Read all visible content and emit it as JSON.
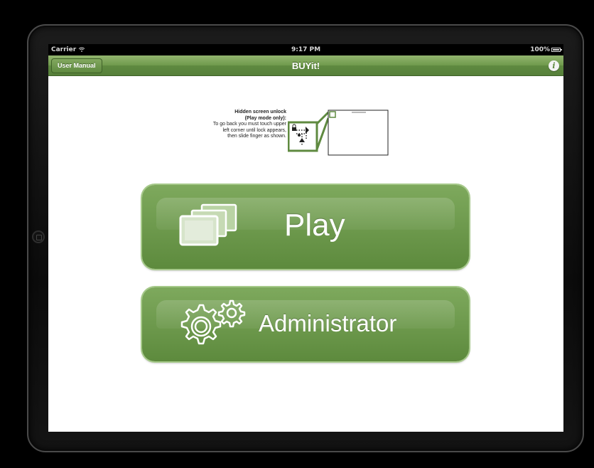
{
  "status_bar": {
    "carrier": "Carrier",
    "time": "9:17 PM",
    "battery": "100%"
  },
  "nav_bar": {
    "title": "BUYit!",
    "left_button": "User Manual",
    "right_icon": "info-icon"
  },
  "hint": {
    "title": "Hidden screen unlock",
    "subtitle": "(Play mode only):",
    "body": "To go back you must touch upper left corner until lock appears, then slide finger as shown."
  },
  "buttons": {
    "play": {
      "label": "Play",
      "icon": "windows-icon"
    },
    "admin": {
      "label": "Administrator",
      "icon": "gears-icon"
    }
  },
  "colors": {
    "accent_green": "#5f8a40",
    "button_highlight": "#a6c98a",
    "background": "#ffffff"
  }
}
